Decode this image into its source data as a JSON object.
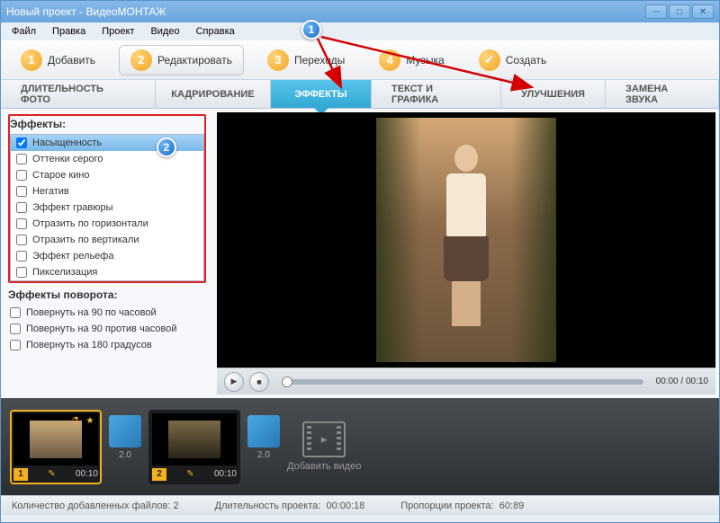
{
  "window": {
    "title": "Новый проект - ВидеоМОНТАЖ"
  },
  "menu": {
    "file": "Файл",
    "edit": "Правка",
    "project": "Проект",
    "video": "Видео",
    "help": "Справка"
  },
  "steps": {
    "add": "Добавить",
    "edit": "Редактировать",
    "transitions": "Переходы",
    "music": "Музыка",
    "create": "Создать",
    "n1": "1",
    "n2": "2",
    "n3": "3",
    "n4": "4",
    "nCheck": "✓"
  },
  "subtabs": {
    "photo_duration": "ДЛИТЕЛЬНОСТЬ ФОТО",
    "crop": "КАДРИРОВАНИЕ",
    "effects": "ЭФФЕКТЫ",
    "text": "ТЕКСТ И ГРАФИКА",
    "improve": "УЛУЧШЕНИЯ",
    "audio": "ЗАМЕНА ЗВУКА"
  },
  "sidebar": {
    "effects_title": "Эффекты:",
    "rotation_title": "Эффекты поворота:",
    "effects": [
      "Насыщенность",
      "Оттенки серого",
      "Старое кино",
      "Негатив",
      "Эффект гравюры",
      "Отразить по горизонтали",
      "Отразить по вертикали",
      "Эффект рельефа",
      "Пикселизация"
    ],
    "rotations": [
      "Повернуть на 90 по часовой",
      "Повернуть на 90 против часовой",
      "Повернуть на 180 градусов"
    ]
  },
  "player": {
    "time_current": "00:00",
    "time_total": "00:10"
  },
  "timeline": {
    "clip1_num": "1",
    "clip1_time": "00:10",
    "clip2_num": "2",
    "clip2_time": "00:10",
    "trans_dur": "2.0",
    "add_label": "Добавить видео"
  },
  "status": {
    "files_label": "Количество добавленных файлов:",
    "files_count": "2",
    "duration_label": "Длительность проекта:",
    "duration_value": "00:00:18",
    "aspect_label": "Пропорции проекта:",
    "aspect_value": "60:89"
  },
  "markers": {
    "m1": "1",
    "m2": "2"
  }
}
